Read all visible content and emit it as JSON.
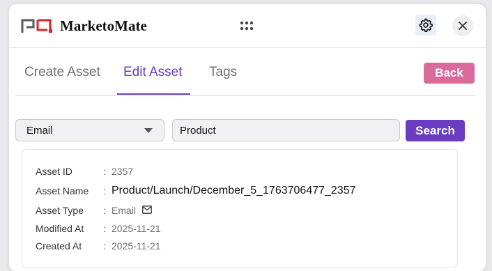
{
  "header": {
    "app_title": "MarketoMate",
    "icons": [
      "logo",
      "grid-icon",
      "gear-icon",
      "close-icon"
    ]
  },
  "tabs": [
    {
      "label": "Create Asset",
      "active": false
    },
    {
      "label": "Edit Asset",
      "active": true
    },
    {
      "label": "Tags",
      "active": false
    }
  ],
  "actions": {
    "back_label": "Back",
    "search_label": "Search"
  },
  "filters": {
    "asset_type_selected": "Email",
    "search_value": "Product"
  },
  "asset": {
    "rows": [
      {
        "label": "Asset ID",
        "value": "2357"
      },
      {
        "label": "Asset Name",
        "value": "Product/Launch/December_5_1763706477_2357"
      },
      {
        "label": "Asset Type",
        "value": "Email"
      },
      {
        "label": "Modified At",
        "value": "2025-11-21"
      },
      {
        "label": "Created At",
        "value": "2025-11-21"
      }
    ]
  },
  "colors": {
    "accent": "#6a3cc1",
    "back_button": "#d96b9b",
    "logo_red": "#d9232e",
    "logo_gray": "#5a5a5a"
  }
}
